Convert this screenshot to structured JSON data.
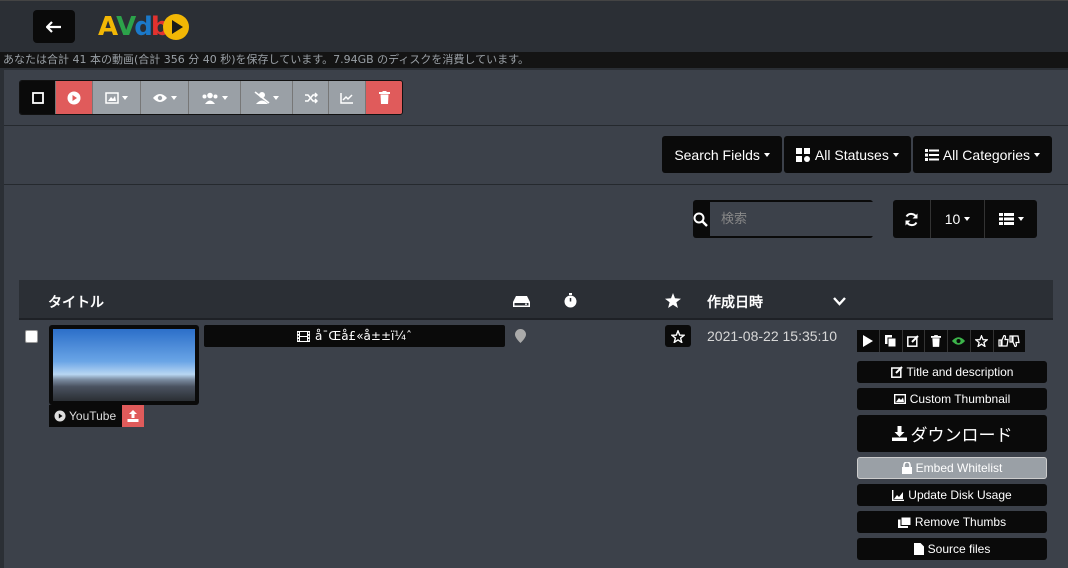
{
  "app": {
    "logo_text": "AVdb",
    "info_text": "あなたは合計 41 本の動画(合計 356 分 40 秒)を保存しています。7.94GB のディスクを消費しています。"
  },
  "filters": {
    "search_fields": "Search Fields",
    "all_statuses": "All Statuses",
    "all_categories": "All Categories"
  },
  "search": {
    "placeholder": "検索"
  },
  "pagination": {
    "page_size": "10"
  },
  "table": {
    "headers": {
      "title": "タイトル",
      "created": "作成日時"
    },
    "rows": [
      {
        "title": "å¯Œå£«å±±ï¼ˆ",
        "source": "YouTube",
        "created": "2021-08-22 15:35:10"
      }
    ]
  },
  "actions": {
    "title_description": "Title and description",
    "custom_thumbnail": "Custom Thumbnail",
    "download": "ダウンロード",
    "embed_whitelist": "Embed Whitelist",
    "update_disk_usage": "Update Disk Usage",
    "remove_thumbs": "Remove Thumbs",
    "source_files": "Source files"
  },
  "colors": {
    "accent_red": "#e05b5b",
    "toolbar_gray": "#9aa0a6",
    "eye_green": "#3cb34a"
  }
}
